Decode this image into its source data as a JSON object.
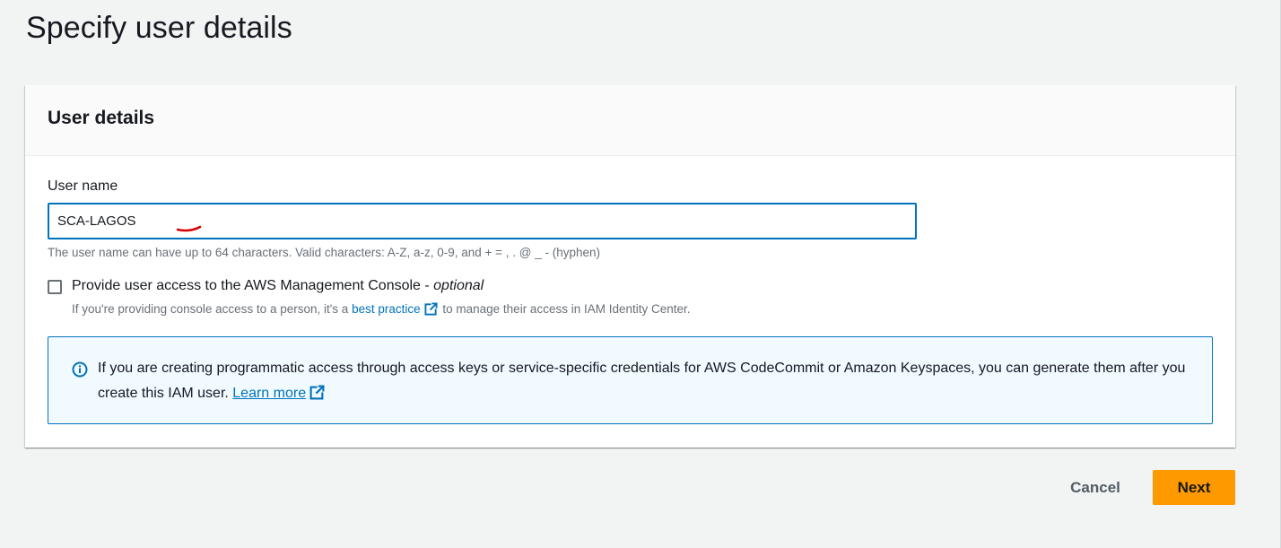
{
  "page": {
    "title": "Specify user details"
  },
  "user_details": {
    "header": "User details",
    "user_name": {
      "label": "User name",
      "value": "SCA-LAGOS",
      "constraint": "The user name can have up to 64 characters. Valid characters: A-Z, a-z, 0-9, and + = , . @ _ - (hyphen)"
    },
    "console_access": {
      "checked": false,
      "label": "Provide user access to the AWS Management Console",
      "separator": " - ",
      "optional": "optional",
      "desc_before": "If you're providing console access to a person, it's a ",
      "desc_link": "best practice",
      "desc_after": " to manage their access in IAM Identity Center."
    },
    "info_alert": {
      "text": "If you are creating programmatic access through access keys or service-specific credentials for AWS CodeCommit or Amazon Keyspaces, you can generate them after you create this IAM user. ",
      "link": "Learn more"
    }
  },
  "actions": {
    "cancel_label": "Cancel",
    "next_label": "Next"
  },
  "colors": {
    "primary_button": "#ff9900",
    "link": "#0073bb",
    "annotation_mark": "#d40000"
  },
  "icons": {
    "external_link": "external-link-icon",
    "info": "info-icon"
  }
}
